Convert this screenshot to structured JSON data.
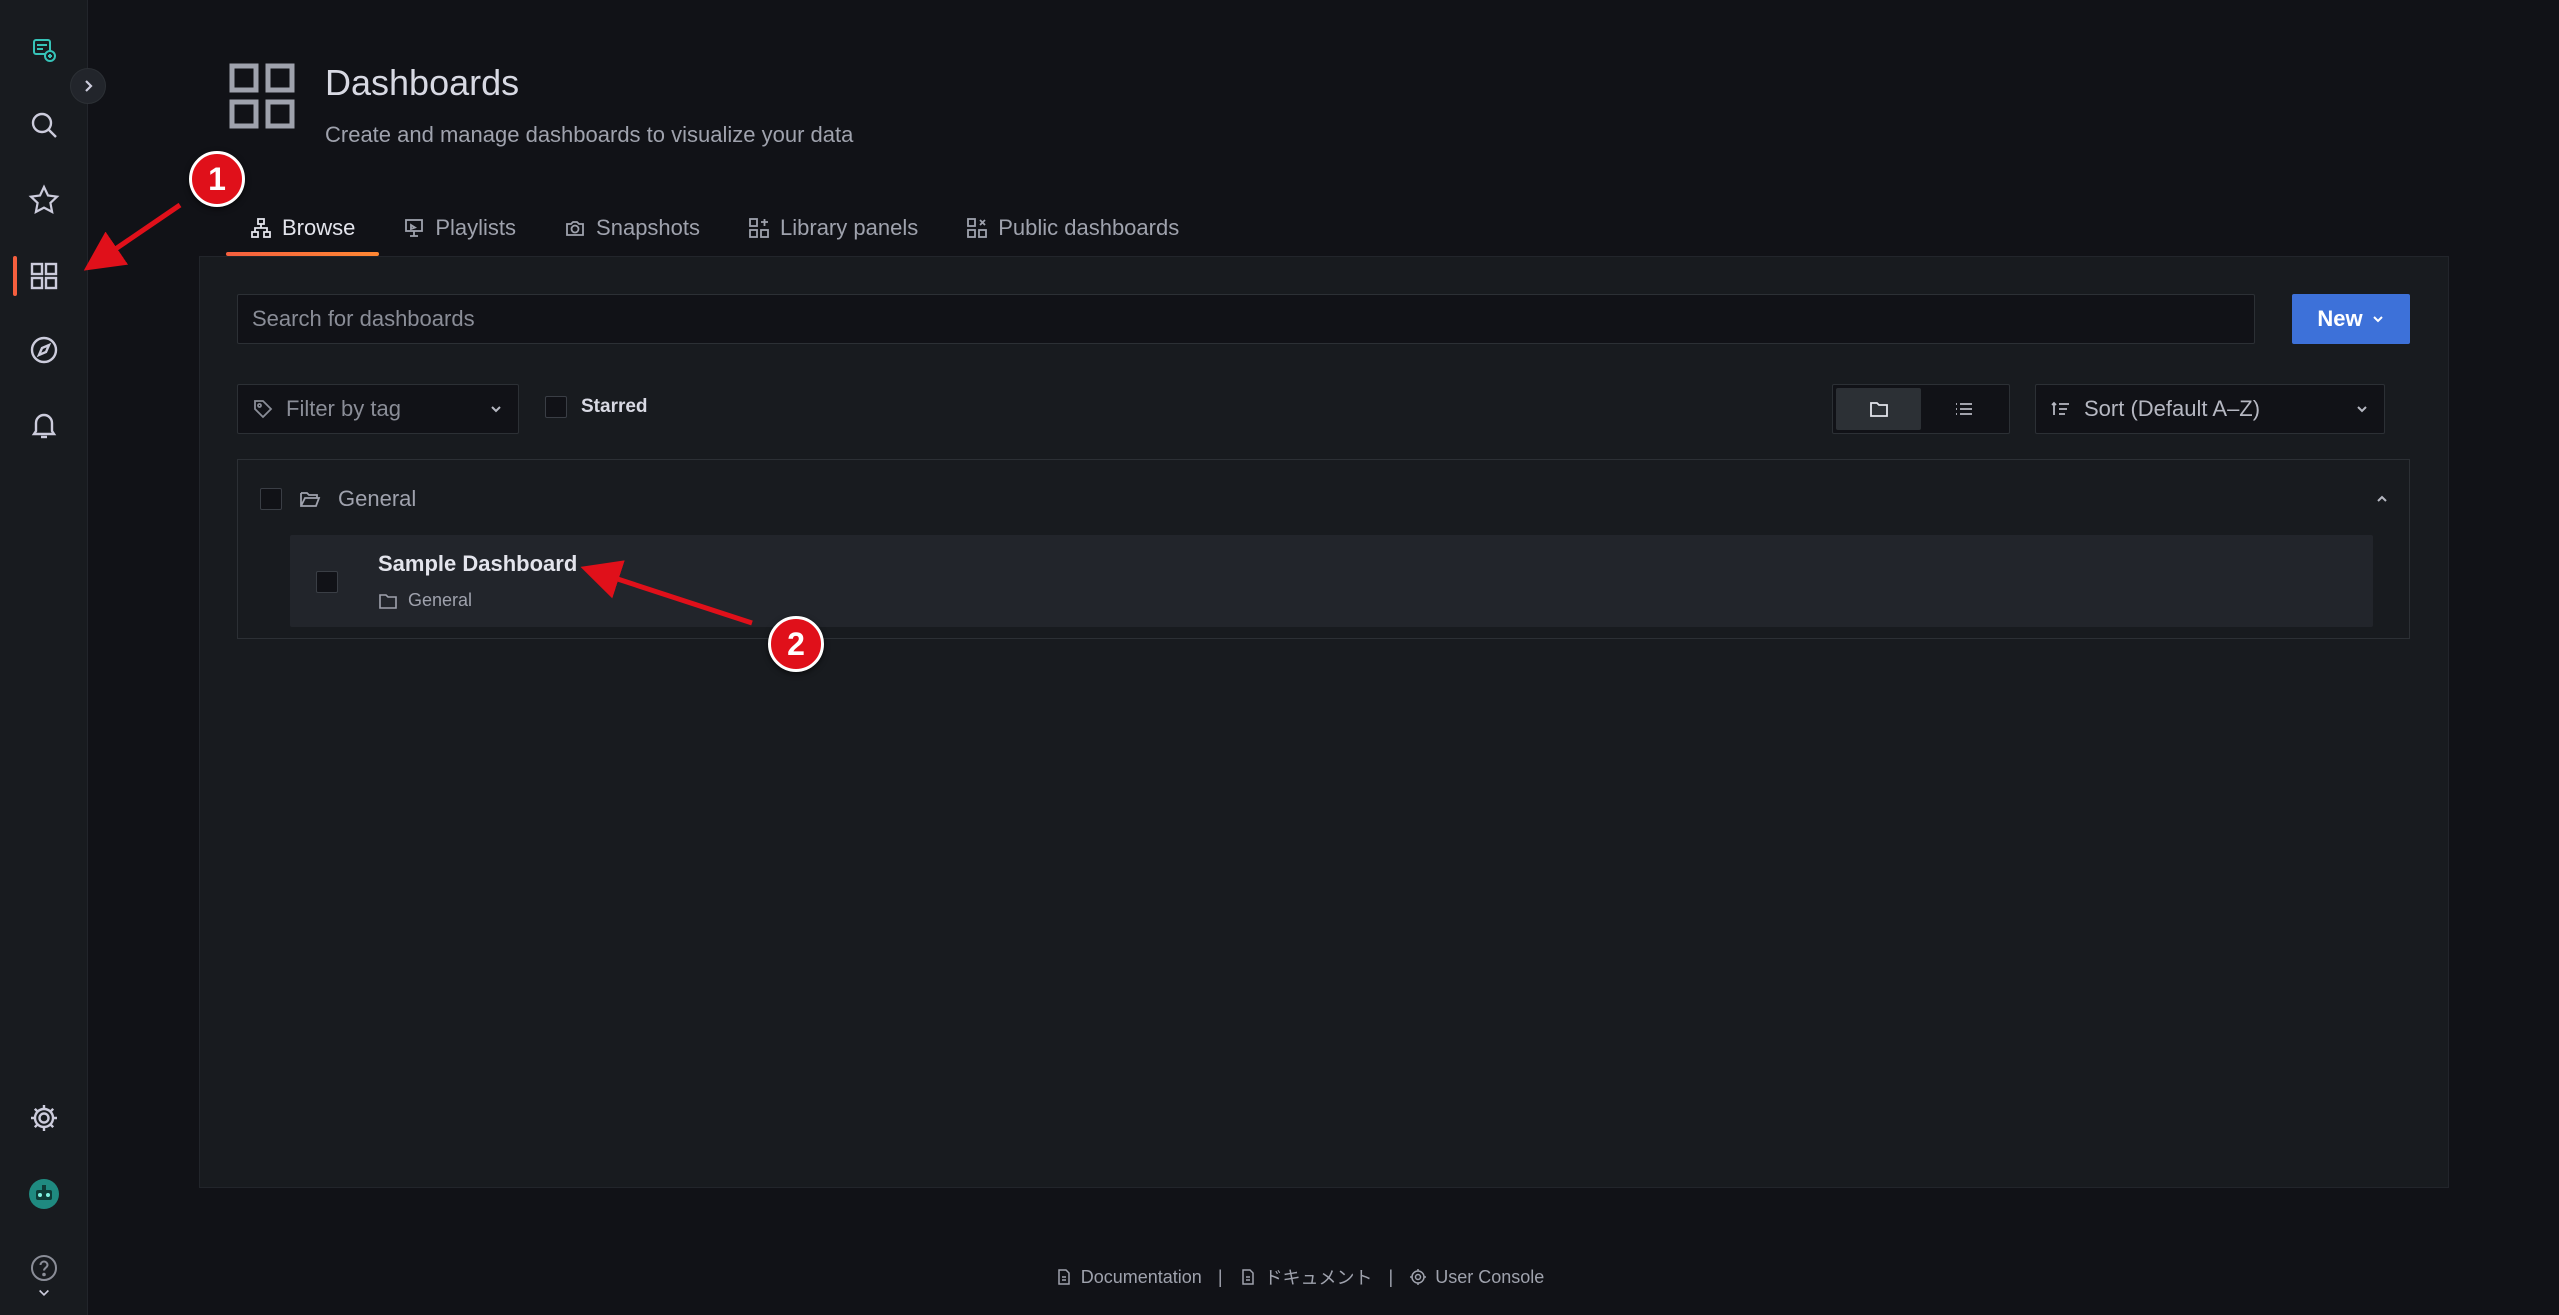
{
  "sidebar": {
    "items": [
      {
        "name": "logo-icon"
      },
      {
        "name": "search-icon"
      },
      {
        "name": "star-icon"
      },
      {
        "name": "dashboards-icon"
      },
      {
        "name": "explore-icon"
      },
      {
        "name": "bell-icon"
      },
      {
        "name": "gear-icon"
      },
      {
        "name": "avatar-icon"
      },
      {
        "name": "help-icon"
      }
    ],
    "active_index": 3,
    "active_color": "#f55f3e"
  },
  "header": {
    "title": "Dashboards",
    "subtitle": "Create and manage dashboards to visualize your data"
  },
  "tabs": [
    {
      "label": "Browse",
      "icon": "sitemap-icon",
      "active": true
    },
    {
      "label": "Playlists",
      "icon": "presentation-icon",
      "active": false
    },
    {
      "label": "Snapshots",
      "icon": "camera-icon",
      "active": false
    },
    {
      "label": "Library panels",
      "icon": "library-panels-icon",
      "active": false
    },
    {
      "label": "Public dashboards",
      "icon": "public-dashboards-icon",
      "active": false
    }
  ],
  "search": {
    "placeholder": "Search for dashboards",
    "value": ""
  },
  "new_button": {
    "label": "New",
    "color": "#3d71d9"
  },
  "filters": {
    "tag_placeholder": "Filter by tag",
    "starred_label": "Starred",
    "sort_label": "Sort (Default A–Z)",
    "view_mode": "folders"
  },
  "folders": [
    {
      "name": "General",
      "expanded": true,
      "dashboards": [
        {
          "title": "Sample Dashboard",
          "folder": "General"
        }
      ]
    }
  ],
  "footer": {
    "documentation": "Documentation",
    "separator": "|",
    "japanese_docs": "ドキュメント",
    "user_console": "User Console"
  },
  "annotations": {
    "badge_1": "1",
    "badge_2": "2",
    "color": "#e0101a"
  }
}
